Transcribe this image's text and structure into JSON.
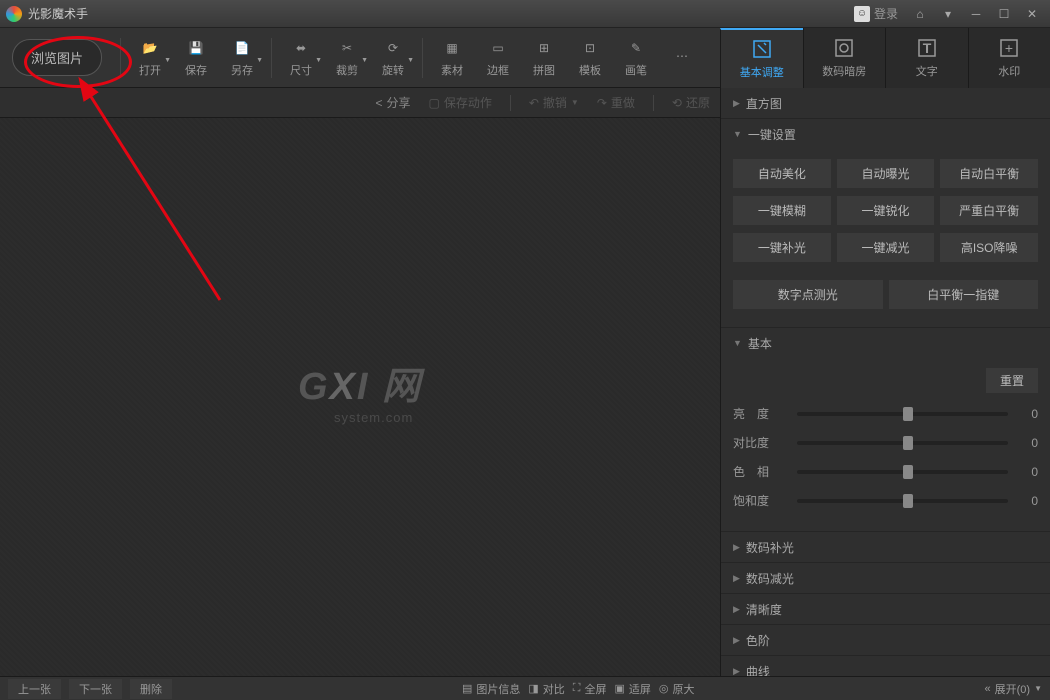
{
  "titlebar": {
    "title": "光影魔术手",
    "login_label": "登录"
  },
  "toolbar": {
    "browse": "浏览图片",
    "items": [
      {
        "label": "打开",
        "dd": true
      },
      {
        "label": "保存",
        "dd": false
      },
      {
        "label": "另存",
        "dd": true
      },
      {
        "label": "尺寸",
        "dd": true
      },
      {
        "label": "裁剪",
        "dd": true
      },
      {
        "label": "旋转",
        "dd": true
      },
      {
        "label": "素材",
        "dd": false
      },
      {
        "label": "边框",
        "dd": false
      },
      {
        "label": "拼图",
        "dd": false
      },
      {
        "label": "模板",
        "dd": false
      },
      {
        "label": "画笔",
        "dd": false
      }
    ]
  },
  "right_tabs": [
    {
      "label": "基本调整",
      "active": true
    },
    {
      "label": "数码暗房",
      "active": false
    },
    {
      "label": "文字",
      "active": false
    },
    {
      "label": "水印",
      "active": false
    }
  ],
  "subtoolbar": {
    "share": "分享",
    "save_action": "保存动作",
    "undo": "撤销",
    "redo": "重做",
    "restore": "还原"
  },
  "panel": {
    "histogram": "直方图",
    "oneclick": {
      "title": "一键设置",
      "buttons": [
        [
          "自动美化",
          "自动曝光",
          "自动白平衡"
        ],
        [
          "一键模糊",
          "一键锐化",
          "严重白平衡"
        ],
        [
          "一键补光",
          "一键减光",
          "高ISO降噪"
        ],
        [
          "数字点测光",
          "白平衡一指键"
        ]
      ]
    },
    "basic": {
      "title": "基本",
      "reset": "重置",
      "sliders": [
        {
          "label": "亮度",
          "value": 0,
          "pos": 50
        },
        {
          "label": "对比度",
          "value": 0,
          "pos": 50
        },
        {
          "label": "色相",
          "value": 0,
          "pos": 50
        },
        {
          "label": "饱和度",
          "value": 0,
          "pos": 50
        }
      ]
    },
    "collapsed": [
      "数码补光",
      "数码减光",
      "清晰度",
      "色阶",
      "曲线"
    ]
  },
  "bottombar": {
    "prev": "上一张",
    "next": "下一张",
    "delete": "删除",
    "info": "图片信息",
    "compare": "对比",
    "fullscreen": "全屏",
    "fit": "适屏",
    "orig": "原大",
    "expand": "展开(0)"
  },
  "watermark": {
    "big_g": "G",
    "big_x": "X",
    "big_i": "I",
    "big_net": "网",
    "small": "system.com"
  }
}
